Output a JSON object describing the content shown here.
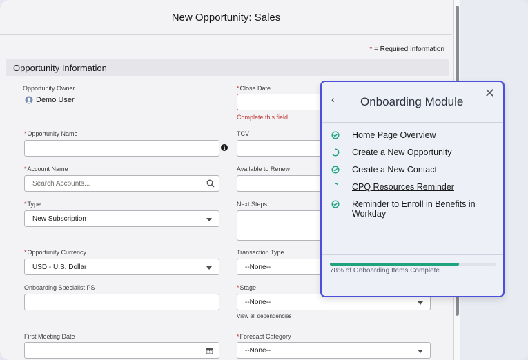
{
  "modal": {
    "title": "New Opportunity: Sales"
  },
  "required_note": {
    "star": "*",
    "text": " = Required Information"
  },
  "section": {
    "title": "Opportunity Information"
  },
  "fields": {
    "owner_label": "Opportunity Owner",
    "owner_value": "Demo User",
    "close_date_label": "Close Date",
    "close_date_error": "Complete this field.",
    "opp_name_label": "Opportunity Name",
    "tcv_label": "TCV",
    "account_label": "Account Name",
    "account_placeholder": "Search Accounts...",
    "renew_label": "Available to Renew",
    "type_label": "Type",
    "type_value": "New Subscription",
    "next_steps_label": "Next Steps",
    "currency_label": "Opportunity Currency",
    "currency_value": "USD - U.S. Dollar",
    "transaction_label": "Transaction Type",
    "transaction_value": "--None--",
    "specialist_label": "Onboarding Specialist PS",
    "stage_label": "Stage",
    "stage_value": "--None--",
    "dependencies_link": "View all dependencies",
    "first_meeting_label": "First Meeting Date",
    "forecast_label": "Forecast Category",
    "forecast_value": "--None--",
    "required_star": "*"
  },
  "onboarding": {
    "title": "Onboarding Module",
    "back_glyph": "‹",
    "close_glyph": "✕",
    "items": [
      {
        "label": "Home Page Overview",
        "status": "complete"
      },
      {
        "label": "Create a New Opportunity",
        "status": "in-progress"
      },
      {
        "label": "Create a New Contact",
        "status": "complete"
      },
      {
        "label": "CPQ Resources Reminder",
        "status": "in-progress"
      },
      {
        "label": "Reminder to Enroll in Benefits in Workday",
        "status": "complete"
      }
    ],
    "progress_percent": 78,
    "progress_text": "78% of Onboarding Items Complete"
  },
  "colors": {
    "accent": "#4b4fd9",
    "complete": "#1ea37a",
    "error": "#c23934"
  }
}
